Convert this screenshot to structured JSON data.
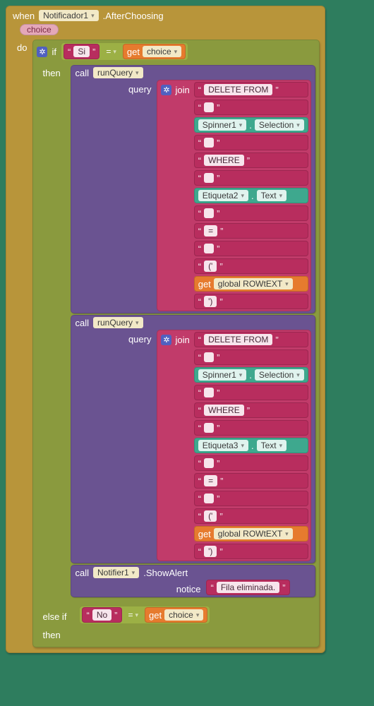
{
  "event": {
    "when": "when",
    "component": "Notificador1",
    "handler": ".AfterChoosing",
    "param": "choice"
  },
  "do_label": "do",
  "if": {
    "keyword": "if",
    "cond": {
      "left_quote_open": "“",
      "left_value": "Si",
      "left_quote_close": "”",
      "op": "=",
      "get": "get",
      "get_var": "choice"
    },
    "then": "then",
    "elseif": "else if",
    "cond2": {
      "left_value": "No",
      "op": "=",
      "get": "get",
      "get_var": "choice"
    },
    "then2": "then"
  },
  "calls": [
    {
      "call": "call",
      "proc": "runQuery",
      "arg_label": "query",
      "join": "join",
      "items": [
        {
          "type": "text",
          "value": "DELETE FROM"
        },
        {
          "type": "text",
          "value": ""
        },
        {
          "type": "teal",
          "comp": "Spinner1",
          "prop": "Selection"
        },
        {
          "type": "text",
          "value": ""
        },
        {
          "type": "text",
          "value": "WHERE"
        },
        {
          "type": "text",
          "value": ""
        },
        {
          "type": "teal",
          "comp": "Etiqueta2",
          "prop": "Text"
        },
        {
          "type": "text",
          "value": ""
        },
        {
          "type": "text",
          "value": "="
        },
        {
          "type": "text",
          "value": ""
        },
        {
          "type": "text",
          "value": "('"
        },
        {
          "type": "get",
          "get": "get",
          "var": "global ROWtEXT"
        },
        {
          "type": "text",
          "value": "')"
        }
      ]
    },
    {
      "call": "call",
      "proc": "runQuery",
      "arg_label": "query",
      "join": "join",
      "items": [
        {
          "type": "text",
          "value": "DELETE FROM"
        },
        {
          "type": "text",
          "value": ""
        },
        {
          "type": "teal",
          "comp": "Spinner1",
          "prop": "Selection"
        },
        {
          "type": "text",
          "value": ""
        },
        {
          "type": "text",
          "value": "WHERE"
        },
        {
          "type": "text",
          "value": ""
        },
        {
          "type": "teal",
          "comp": "Etiqueta3",
          "prop": "Text"
        },
        {
          "type": "text",
          "value": ""
        },
        {
          "type": "text",
          "value": "="
        },
        {
          "type": "text",
          "value": ""
        },
        {
          "type": "text",
          "value": "('"
        },
        {
          "type": "get",
          "get": "get",
          "var": "global ROWtEXT"
        },
        {
          "type": "text",
          "value": "')"
        }
      ]
    },
    {
      "call": "call",
      "proc": "Notifier1",
      "suffix": ".ShowAlert",
      "arg_label": "notice",
      "notice_value": "Fila eliminada."
    }
  ]
}
